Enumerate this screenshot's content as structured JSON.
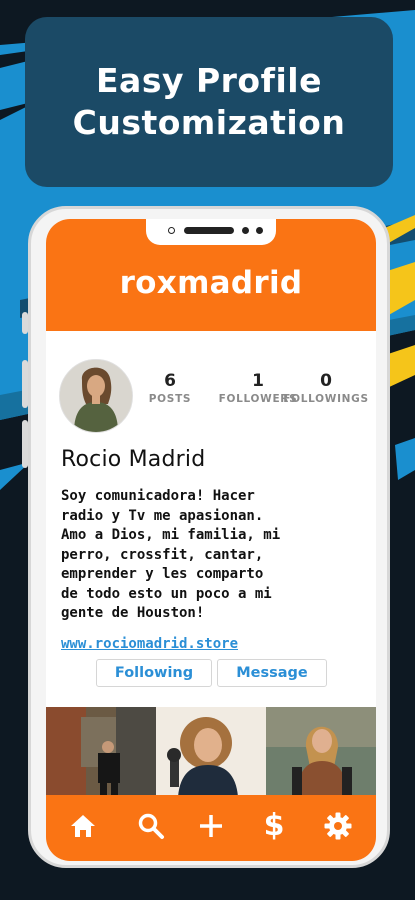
{
  "headline": {
    "line1": "Easy Profile",
    "line2": "Customization"
  },
  "profile": {
    "username": "roxmadrid",
    "full_name": "Rocio Madrid",
    "bio": "Soy comunicadora! Hacer\nradio y Tv me apasionan.\nAmo a Dios, mi familia, mi\nperro, crossfit, cantar,\nemprender y les comparto\nde todo esto un poco a mi\ngente de Houston!",
    "website": "www.rociomadrid.store",
    "stats": [
      {
        "value": "6",
        "label": "POSTS"
      },
      {
        "value": "1",
        "label": "FOLLOWERS"
      },
      {
        "value": "0",
        "label": "FOLLOWINGS"
      }
    ]
  },
  "actions": {
    "following_label": "Following",
    "message_label": "Message"
  },
  "bottom_nav": [
    "home-icon",
    "search-icon",
    "add-icon",
    "dollar-icon",
    "settings-icon"
  ],
  "nav_dollar_glyph": "$",
  "colors": {
    "accent": "#fa7414",
    "link": "#2b8fd6",
    "headline_card": "#1b4a66",
    "stripe_blue": "#1a8fcf",
    "stripe_yellow": "#f5c51a"
  }
}
